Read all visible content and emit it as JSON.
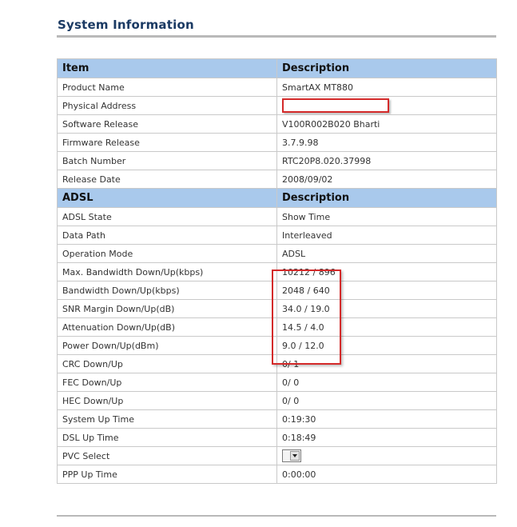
{
  "page": {
    "title": "System Information"
  },
  "table": {
    "header1": {
      "item": "Item",
      "description": "Description"
    },
    "rows1": [
      {
        "item": "Product Name",
        "value": "SmartAX MT880"
      },
      {
        "item": "Physical Address",
        "value": ""
      },
      {
        "item": "Software Release",
        "value": "V100R002B020 Bharti"
      },
      {
        "item": "Firmware Release",
        "value": "3.7.9.98"
      },
      {
        "item": "Batch Number",
        "value": "RTC20P8.020.37998"
      },
      {
        "item": "Release Date",
        "value": "2008/09/02"
      }
    ],
    "header2": {
      "item": "ADSL",
      "description": "Description"
    },
    "rows2": [
      {
        "item": "ADSL State",
        "value": "Show Time"
      },
      {
        "item": "Data Path",
        "value": "Interleaved"
      },
      {
        "item": "Operation Mode",
        "value": "ADSL"
      },
      {
        "item": "Max. Bandwidth Down/Up(kbps)",
        "value": "10212 / 896"
      },
      {
        "item": "Bandwidth Down/Up(kbps)",
        "value": "2048 / 640"
      },
      {
        "item": "SNR Margin Down/Up(dB)",
        "value": "34.0 / 19.0"
      },
      {
        "item": "Attenuation Down/Up(dB)",
        "value": "14.5 / 4.0"
      },
      {
        "item": "Power Down/Up(dBm)",
        "value": "9.0 / 12.0"
      },
      {
        "item": "CRC Down/Up",
        "value": "0/ 1"
      },
      {
        "item": "FEC  Down/Up",
        "value": "0/ 0"
      },
      {
        "item": "HEC Down/Up",
        "value": "0/ 0"
      },
      {
        "item": "System Up Time",
        "value": "0:19:30"
      },
      {
        "item": "DSL Up Time",
        "value": "0:18:49"
      },
      {
        "item": "PVC Select",
        "value": ""
      },
      {
        "item": "PPP Up Time",
        "value": "0:00:00"
      }
    ]
  },
  "colors": {
    "title": "#1b3a63",
    "header_bg": "#a9c9ec",
    "status_text": "#f0a020",
    "annotation_red": "#d42a2a"
  }
}
